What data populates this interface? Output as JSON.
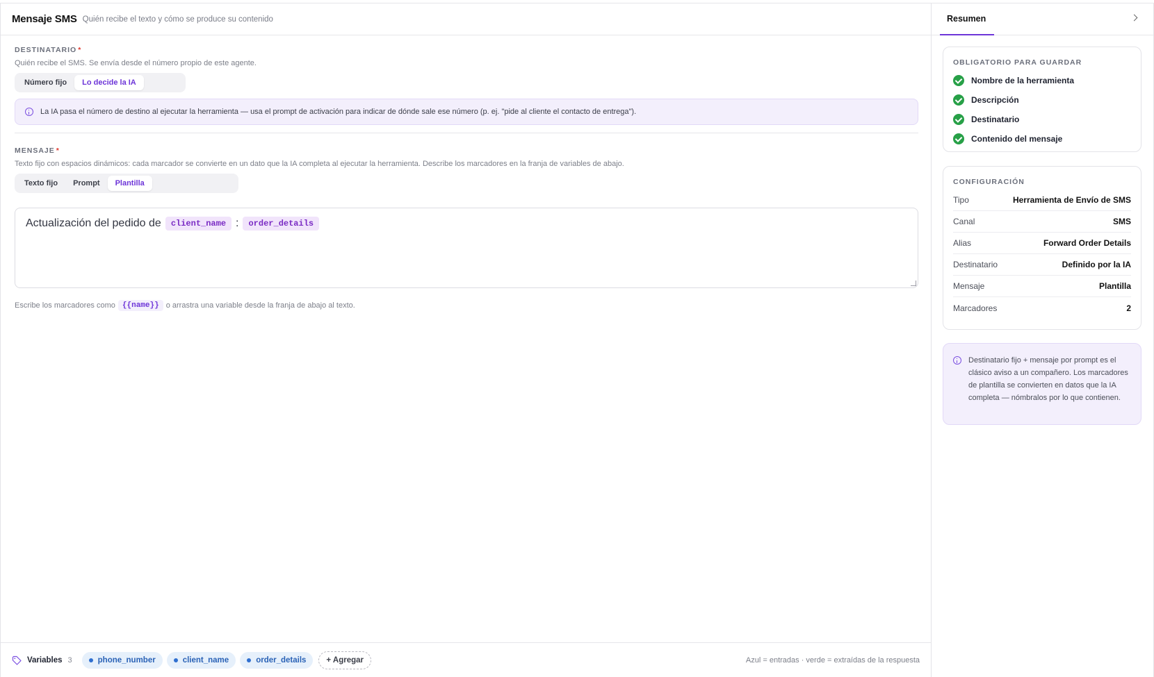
{
  "header": {
    "title": "Mensaje SMS",
    "subtitle": "Quién recibe el texto y cómo se produce su contenido"
  },
  "recipient": {
    "label": "DESTINATARIO",
    "required": "*",
    "help": "Quién recibe el SMS. Se envía desde el número propio de este agente.",
    "options": [
      "Número fijo",
      "Lo decide la IA"
    ],
    "selected": "Lo decide la IA",
    "info": "La IA pasa el número de destino al ejecutar la herramienta — usa el prompt de activación para indicar de dónde sale ese número (p. ej. \"pide al cliente el contacto de entrega\")."
  },
  "message": {
    "label": "MENSAJE",
    "required": "*",
    "help": "Texto fijo con espacios dinámicos: cada marcador se convierte en un dato que la IA completa al ejecutar la herramienta. Describe los marcadores en la franja de variables de abajo.",
    "options": [
      "Texto fijo",
      "Prompt",
      "Plantilla"
    ],
    "selected": "Plantilla",
    "template_text": "Actualización del pedido de",
    "template_tag_1": "client_name",
    "template_sep": ":",
    "template_tag_2": "order_details",
    "hint_before": "Escribe los marcadores como",
    "hint_code": "{{name}}",
    "hint_after": "o arrastra una variable desde la franja de abajo al texto."
  },
  "variables_bar": {
    "label": "Variables",
    "count": "3",
    "items": [
      "phone_number",
      "client_name",
      "order_details"
    ],
    "add_label": "+ Agregar",
    "legend": "Azul = entradas · verde = extraídas de la respuesta"
  },
  "sidebar": {
    "tab": "Resumen",
    "required_title": "OBLIGATORIO PARA GUARDAR",
    "required_items": [
      "Nombre de la herramienta",
      "Descripción",
      "Destinatario",
      "Contenido del mensaje"
    ],
    "config_title": "CONFIGURACIÓN",
    "config_rows": [
      {
        "key": "Tipo",
        "value": "Herramienta de Envío de SMS"
      },
      {
        "key": "Canal",
        "value": "SMS"
      },
      {
        "key": "Alias",
        "value": "Forward Order Details"
      },
      {
        "key": "Destinatario",
        "value": "Definido por la IA"
      },
      {
        "key": "Mensaje",
        "value": "Plantilla"
      },
      {
        "key": "Marcadores",
        "value": "2"
      }
    ],
    "note": "Destinatario fijo + mensaje por prompt es el clásico aviso a un compañero. Los marcadores de plantilla se convierten en datos que la IA completa — nómbralos por lo que contienen."
  },
  "colors": {
    "accent": "#6d35d8",
    "success": "#27a047",
    "input_chip": "#2f6fd0"
  }
}
